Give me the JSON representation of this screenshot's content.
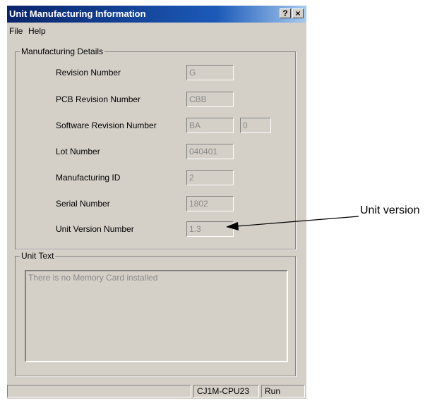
{
  "window": {
    "title": "Unit Manufacturing Information",
    "help_button": "?",
    "close_button": "×"
  },
  "menu": {
    "items": [
      "File",
      "Help"
    ]
  },
  "manufacturing": {
    "legend": "Manufacturing Details",
    "rows": [
      {
        "label": "Revision Number",
        "value": "G"
      },
      {
        "label": "PCB Revision Number",
        "value": "CBB"
      },
      {
        "label": "Software Revision Number",
        "value": "BA",
        "value2": "0"
      },
      {
        "label": "Lot Number",
        "value": "040401"
      },
      {
        "label": "Manufacturing ID",
        "value": "2"
      },
      {
        "label": "Serial Number",
        "value": "1802"
      },
      {
        "label": "Unit Version Number",
        "value": "1.3"
      }
    ]
  },
  "unit_text": {
    "legend": "Unit Text",
    "content": "There is no Memory Card installed"
  },
  "status": {
    "model": "CJ1M-CPU23",
    "mode": "Run"
  },
  "annotation": {
    "label": "Unit version"
  }
}
